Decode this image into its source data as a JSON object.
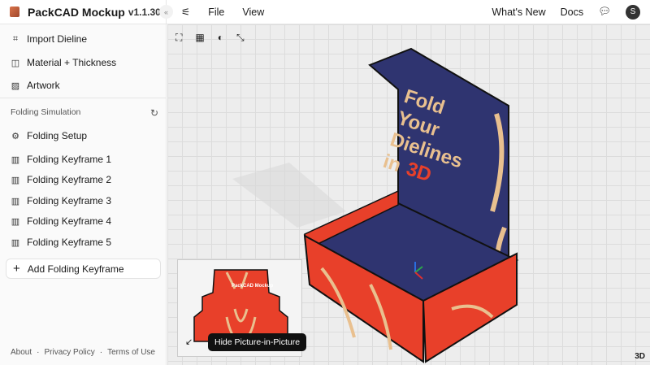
{
  "app": {
    "title": "PackCAD Mockup",
    "version": "v1.1.30"
  },
  "menu": {
    "file": "File",
    "view": "View"
  },
  "header_right": {
    "whats_new": "What's New",
    "docs": "Docs",
    "avatar": "S"
  },
  "sidebar": {
    "items": [
      {
        "label": "Import Dieline",
        "icon": "dieline-icon"
      },
      {
        "label": "Material + Thickness",
        "icon": "material-icon"
      },
      {
        "label": "Artwork",
        "icon": "image-icon"
      }
    ],
    "section": "Folding Simulation",
    "folding": [
      {
        "label": "Folding Setup",
        "icon": "gear-icon"
      },
      {
        "label": "Folding Keyframe 1",
        "icon": "map-icon"
      },
      {
        "label": "Folding Keyframe 2",
        "icon": "map-icon"
      },
      {
        "label": "Folding Keyframe 3",
        "icon": "map-icon"
      },
      {
        "label": "Folding Keyframe 4",
        "icon": "map-icon"
      },
      {
        "label": "Folding Keyframe 5",
        "icon": "map-icon"
      }
    ],
    "add": "Add Folding Keyframe"
  },
  "footer": {
    "about": "About",
    "sep": "·",
    "privacy": "Privacy Policy",
    "terms": "Terms of Use"
  },
  "viewport": {
    "box_text": [
      "Fold",
      "Your",
      "Dielines",
      "in",
      "3D"
    ],
    "pip_logo": "PackCAD Mockup",
    "pip_tooltip": "Hide Picture-in-Picture",
    "mode": "3D"
  },
  "colors": {
    "red": "#e8402a",
    "navy": "#2f3470",
    "cream": "#e9c08f"
  }
}
